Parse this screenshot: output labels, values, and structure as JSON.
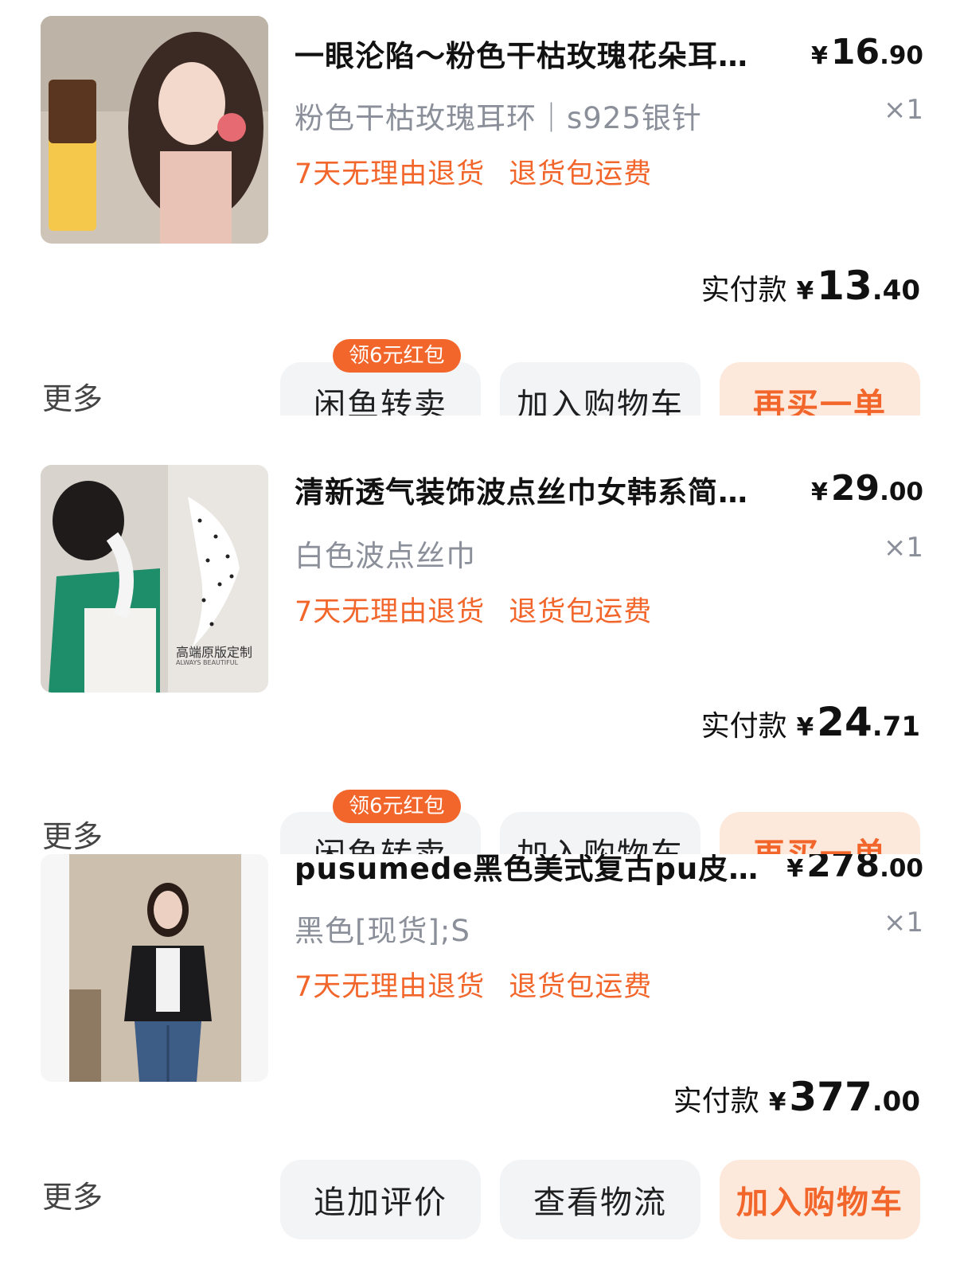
{
  "orders": [
    {
      "title": "一眼沦陷～粉色干枯玫瑰花朵耳…",
      "price_int": "16",
      "price_dec": ".90",
      "spec": "粉色干枯玫瑰耳环｜s925银针",
      "qty": "×1",
      "tags": [
        "7天无理由退货",
        "退货包运费"
      ],
      "paid_label": "实付款",
      "paid_int": "13",
      "paid_dec": ".40",
      "more": "更多",
      "buttons": [
        "闲鱼转卖",
        "加入购物车",
        "再买一单"
      ],
      "badge": "领6元红包"
    },
    {
      "title": "清新透气装饰波点丝巾女韩系简…",
      "price_int": "29",
      "price_dec": ".00",
      "spec": "白色波点丝巾",
      "qty": "×1",
      "tags": [
        "7天无理由退货",
        "退货包运费"
      ],
      "paid_label": "实付款",
      "paid_int": "24",
      "paid_dec": ".71",
      "more": "更多",
      "buttons": [
        "闲鱼转卖",
        "加入购物车",
        "再买一单"
      ],
      "badge": "领6元红包",
      "image_caption": "高端原版定制",
      "image_subcaption": "ALWAYS BEAUTIFUL"
    },
    {
      "title": "pusumede黑色美式复古pu皮…",
      "price_int": "278",
      "price_dec": ".00",
      "spec": "黑色[现货];S",
      "qty": "×1",
      "tags": [
        "7天无理由退货",
        "退货包运费"
      ],
      "paid_label": "实付款",
      "paid_int": "377",
      "paid_dec": ".00",
      "more": "更多",
      "buttons": [
        "追加评价",
        "查看物流",
        "加入购物车"
      ]
    }
  ],
  "currency": "¥",
  "colors": {
    "accent": "#f2662b",
    "muted": "#8a8f99",
    "button_bg": "#f3f4f6",
    "primary_bg": "#fde9dc"
  },
  "icons": [
    "product-image-earrings",
    "product-image-scarf",
    "product-image-jacket"
  ]
}
